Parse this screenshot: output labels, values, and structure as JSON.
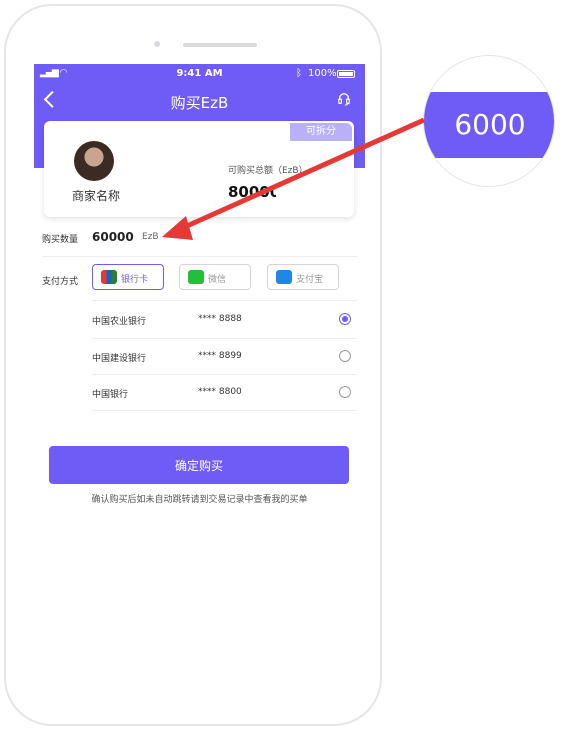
{
  "status_bar": {
    "time": "9:41 AM",
    "battery": "100%"
  },
  "nav": {
    "title": "购买EzB"
  },
  "card": {
    "badge": "可拆分",
    "merchant_name": "商家名称",
    "total_label": "可购买总额（EzB）",
    "total_value": "80000"
  },
  "purchase": {
    "label": "购买数量",
    "value": "60000",
    "unit": "EzB"
  },
  "payment": {
    "label": "支付方式",
    "methods": [
      {
        "label": "银行卡",
        "icon": "unionpay-icon",
        "selected": true
      },
      {
        "label": "微信",
        "icon": "wechat-icon",
        "selected": false
      },
      {
        "label": "支付宝",
        "icon": "alipay-icon",
        "selected": false
      }
    ]
  },
  "banks": [
    {
      "name": "中国农业银行",
      "number": "**** 8888",
      "selected": true
    },
    {
      "name": "中国建设银行",
      "number": "**** 8899",
      "selected": false
    },
    {
      "name": "中国银行",
      "number": "**** 8800",
      "selected": false
    }
  ],
  "confirm": {
    "label": "确定购买"
  },
  "note": "确认购买后如未自动跳转请到交易记录中查看我的买单",
  "annotation": {
    "zoom_value": "6000"
  },
  "colors": {
    "accent": "#6f5cf6",
    "arrow": "#e53935"
  }
}
